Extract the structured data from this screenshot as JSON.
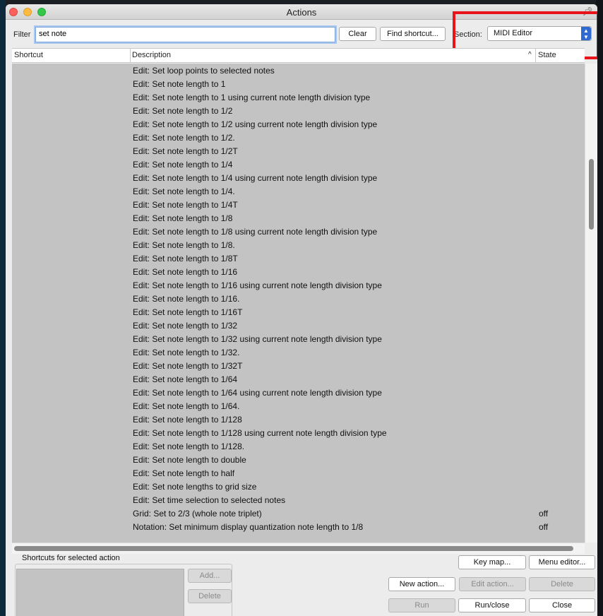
{
  "window": {
    "title": "Actions"
  },
  "filter": {
    "label": "Filter",
    "value": "set note"
  },
  "buttons": {
    "clear": "Clear",
    "find_shortcut": "Find shortcut...",
    "key_map": "Key map...",
    "menu_editor": "Menu editor...",
    "new_action": "New action...",
    "edit_action": "Edit action...",
    "delete": "Delete",
    "run": "Run",
    "run_close": "Run/close",
    "close": "Close",
    "add": "Add...",
    "shortcut_delete": "Delete"
  },
  "section": {
    "label": "Section:",
    "value": "MIDI Editor"
  },
  "table": {
    "columns": [
      "Shortcut",
      "Description",
      "State"
    ],
    "rows": [
      {
        "description": "Edit: Set loop points to selected notes",
        "state": ""
      },
      {
        "description": "Edit: Set note length to 1",
        "state": ""
      },
      {
        "description": "Edit: Set note length to 1 using current note length division type",
        "state": ""
      },
      {
        "description": "Edit: Set note length to 1/2",
        "state": ""
      },
      {
        "description": "Edit: Set note length to 1/2 using current note length division type",
        "state": ""
      },
      {
        "description": "Edit: Set note length to 1/2.",
        "state": ""
      },
      {
        "description": "Edit: Set note length to 1/2T",
        "state": ""
      },
      {
        "description": "Edit: Set note length to 1/4",
        "state": ""
      },
      {
        "description": "Edit: Set note length to 1/4 using current note length division type",
        "state": ""
      },
      {
        "description": "Edit: Set note length to 1/4.",
        "state": ""
      },
      {
        "description": "Edit: Set note length to 1/4T",
        "state": ""
      },
      {
        "description": "Edit: Set note length to 1/8",
        "state": ""
      },
      {
        "description": "Edit: Set note length to 1/8 using current note length division type",
        "state": ""
      },
      {
        "description": "Edit: Set note length to 1/8.",
        "state": ""
      },
      {
        "description": "Edit: Set note length to 1/8T",
        "state": ""
      },
      {
        "description": "Edit: Set note length to 1/16",
        "state": ""
      },
      {
        "description": "Edit: Set note length to 1/16 using current note length division type",
        "state": ""
      },
      {
        "description": "Edit: Set note length to 1/16.",
        "state": ""
      },
      {
        "description": "Edit: Set note length to 1/16T",
        "state": ""
      },
      {
        "description": "Edit: Set note length to 1/32",
        "state": ""
      },
      {
        "description": "Edit: Set note length to 1/32 using current note length division type",
        "state": ""
      },
      {
        "description": "Edit: Set note length to 1/32.",
        "state": ""
      },
      {
        "description": "Edit: Set note length to 1/32T",
        "state": ""
      },
      {
        "description": "Edit: Set note length to 1/64",
        "state": ""
      },
      {
        "description": "Edit: Set note length to 1/64 using current note length division type",
        "state": ""
      },
      {
        "description": "Edit: Set note length to 1/64.",
        "state": ""
      },
      {
        "description": "Edit: Set note length to 1/128",
        "state": ""
      },
      {
        "description": "Edit: Set note length to 1/128 using current note length division type",
        "state": ""
      },
      {
        "description": "Edit: Set note length to 1/128.",
        "state": ""
      },
      {
        "description": "Edit: Set note length to double",
        "state": ""
      },
      {
        "description": "Edit: Set note length to half",
        "state": ""
      },
      {
        "description": "Edit: Set note lengths to grid size",
        "state": ""
      },
      {
        "description": "Edit: Set time selection to selected notes",
        "state": ""
      },
      {
        "description": "Grid: Set to 2/3 (whole note triplet)",
        "state": "off"
      },
      {
        "description": "Notation: Set minimum display quantization note length to 1/8",
        "state": "off"
      }
    ]
  },
  "shortcuts_panel": {
    "title": "Shortcuts for selected action"
  },
  "colors": {
    "highlight": "#e8141b",
    "accent": "#2e6ad1"
  }
}
